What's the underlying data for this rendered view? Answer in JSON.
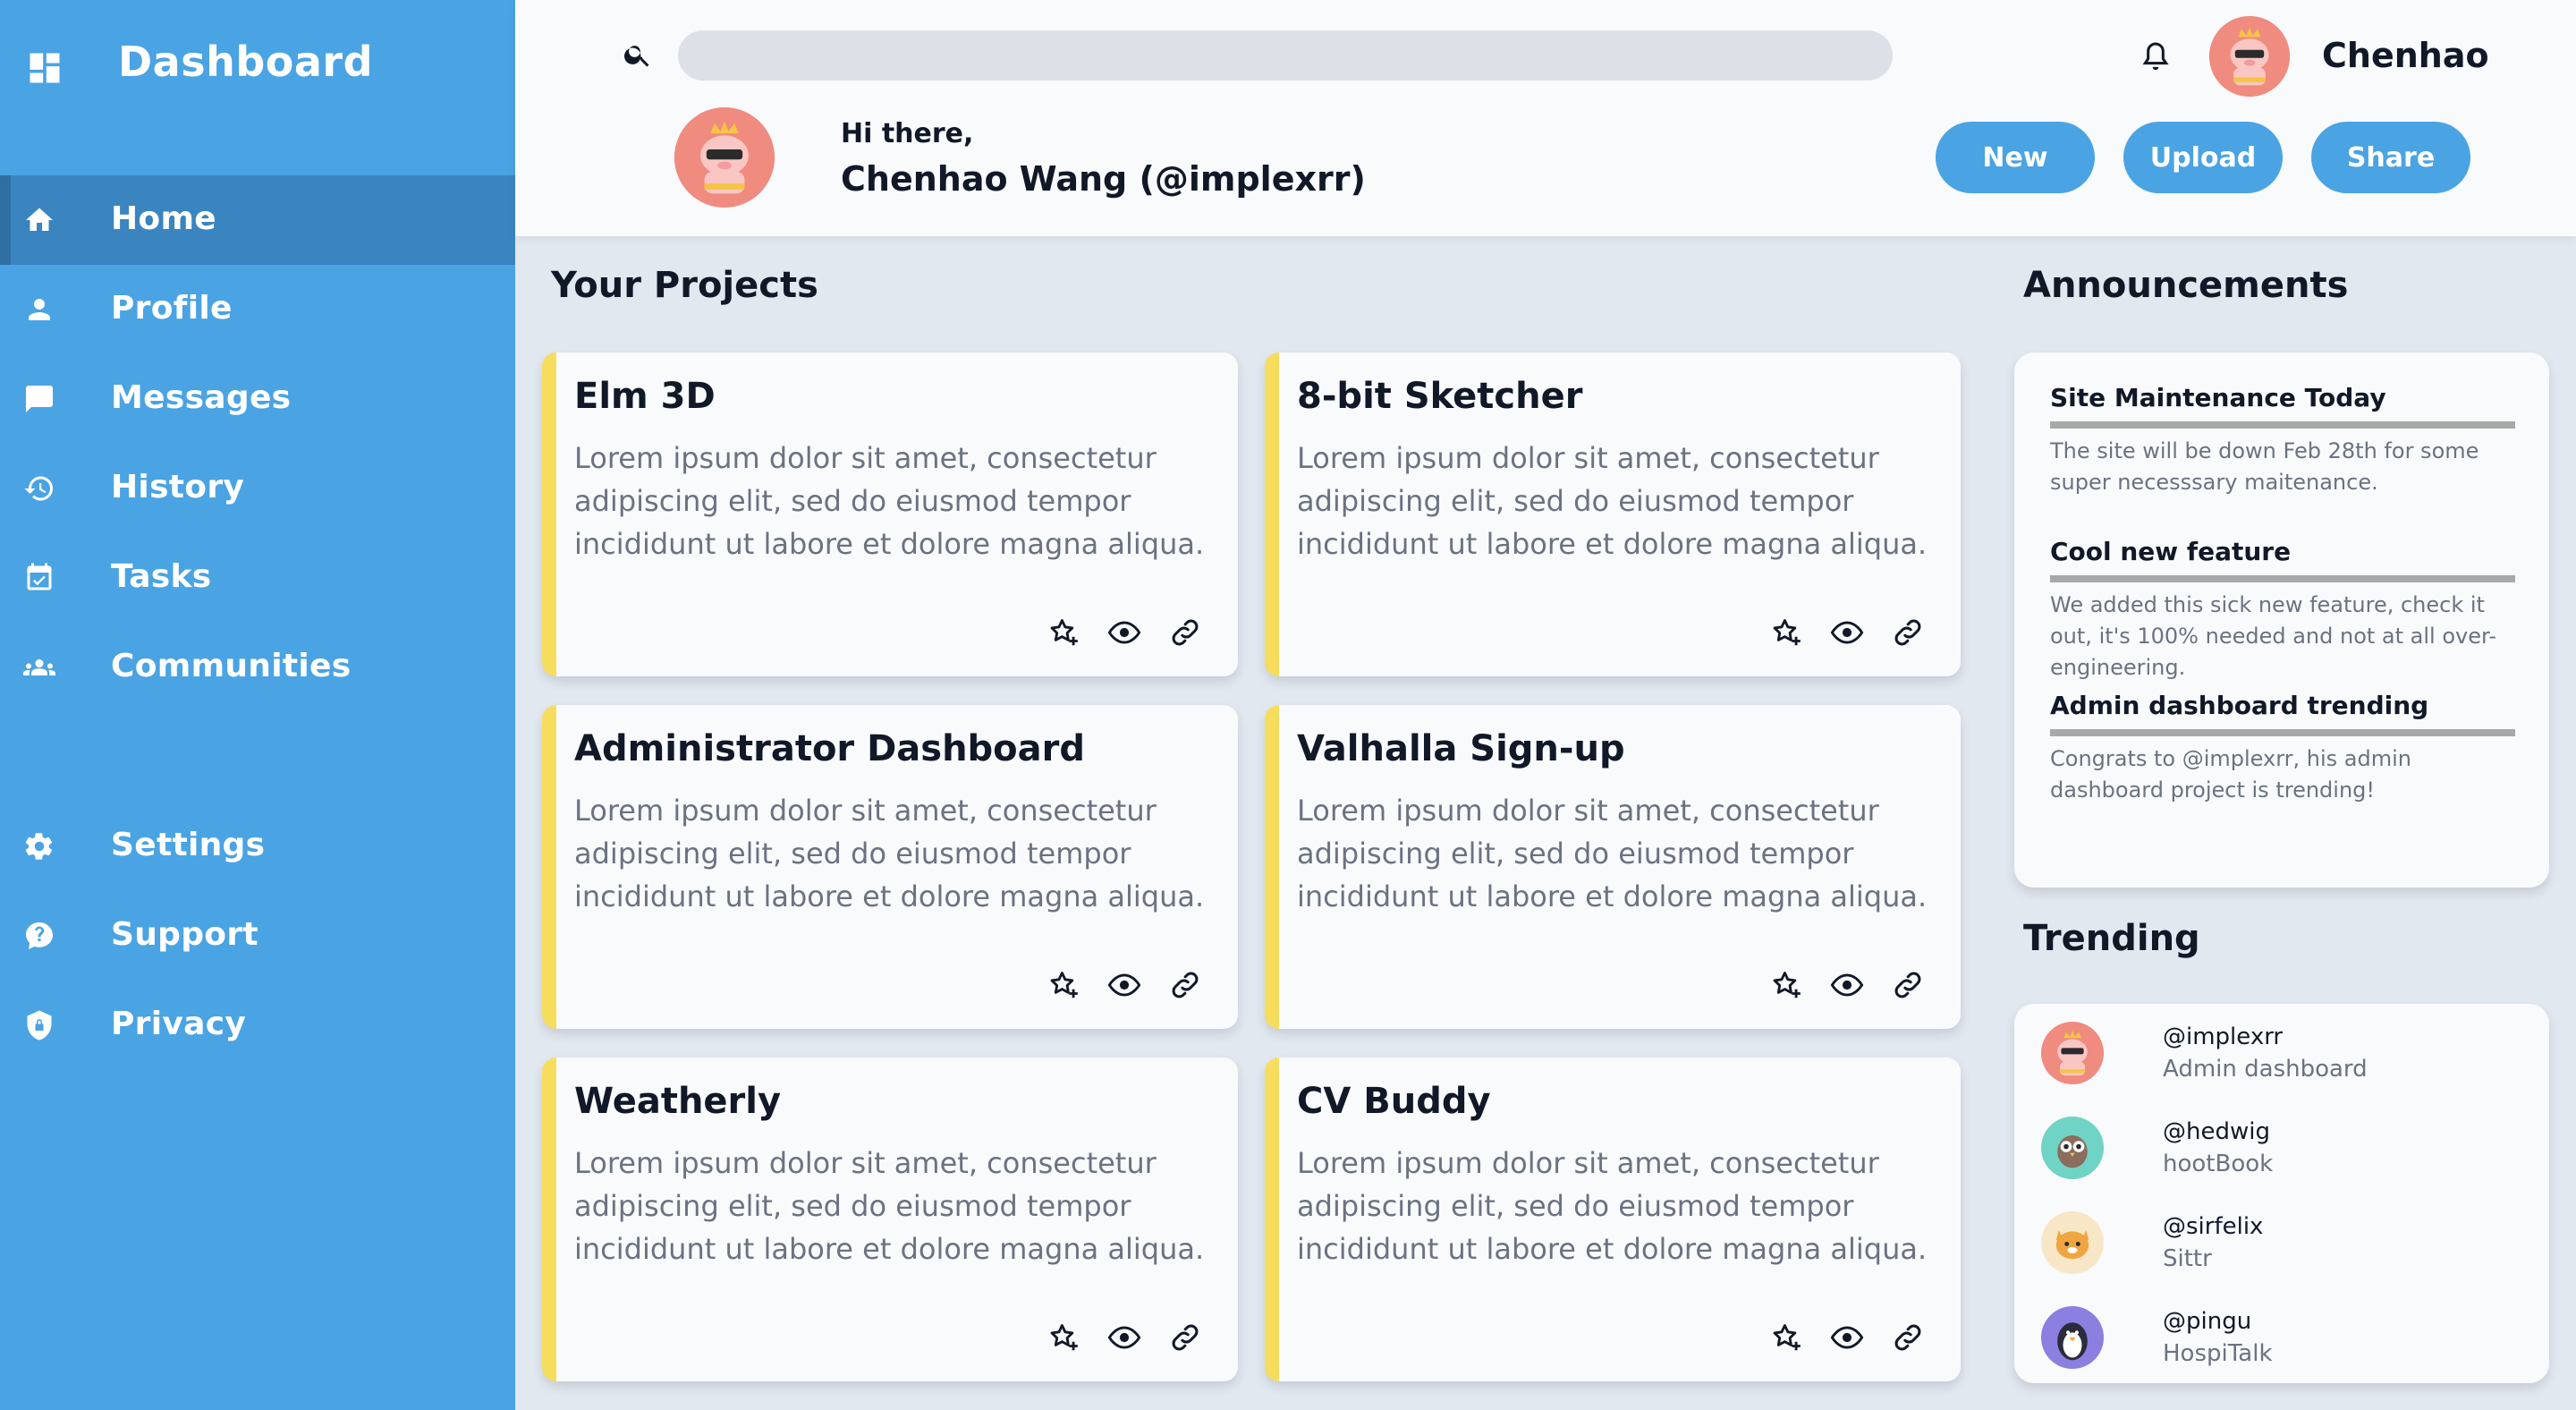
{
  "sidebar": {
    "title": "Dashboard",
    "items": [
      {
        "label": "Home",
        "icon": "home-icon",
        "active": true
      },
      {
        "label": "Profile",
        "icon": "person-icon"
      },
      {
        "label": "Messages",
        "icon": "chat-icon"
      },
      {
        "label": "History",
        "icon": "history-icon"
      },
      {
        "label": "Tasks",
        "icon": "calendar-check-icon"
      },
      {
        "label": "Communities",
        "icon": "group-icon"
      }
    ],
    "bottom_items": [
      {
        "label": "Settings",
        "icon": "gear-icon"
      },
      {
        "label": "Support",
        "icon": "help-chat-icon"
      },
      {
        "label": "Privacy",
        "icon": "shield-lock-icon"
      }
    ]
  },
  "header": {
    "search": {
      "value": "",
      "placeholder": ""
    },
    "username": "Chenhao",
    "greeting": "Hi there,",
    "full_name": "Chenhao Wang (@implexrr)",
    "buttons": {
      "new": "New",
      "upload": "Upload",
      "share": "Share"
    }
  },
  "projects": {
    "title": "Your Projects",
    "items": [
      {
        "title": "Elm 3D",
        "description": "Lorem ipsum dolor sit amet, consectetur adipiscing elit, sed do eiusmod tempor incididunt ut labore et dolore magna aliqua."
      },
      {
        "title": "8-bit Sketcher",
        "description": "Lorem ipsum dolor sit amet, consectetur adipiscing elit, sed do eiusmod tempor incididunt ut labore et dolore magna aliqua."
      },
      {
        "title": "Administrator Dashboard",
        "description": "Lorem ipsum dolor sit amet, consectetur adipiscing elit, sed do eiusmod tempor incididunt ut labore et dolore magna aliqua."
      },
      {
        "title": "Valhalla Sign-up",
        "description": "Lorem ipsum dolor sit amet, consectetur adipiscing elit, sed do eiusmod tempor incididunt ut labore et dolore magna aliqua."
      },
      {
        "title": "Weatherly",
        "description": "Lorem ipsum dolor sit amet, consectetur adipiscing elit, sed do eiusmod tempor incididunt ut labore et dolore magna aliqua."
      },
      {
        "title": "CV Buddy",
        "description": "Lorem ipsum dolor sit amet, consectetur adipiscing elit, sed do eiusmod tempor incididunt ut labore et dolore magna aliqua."
      }
    ],
    "actions": [
      "star-add-icon",
      "eye-icon",
      "link-icon"
    ]
  },
  "announcements": {
    "title": "Announcements",
    "items": [
      {
        "title": "Site Maintenance Today",
        "body": "The site will be down Feb 28th for some super necesssary maitenance."
      },
      {
        "title": "Cool new feature",
        "body": "We added this sick new feature, check it out, it's 100% needed and not at all over-engineering."
      },
      {
        "title": "Admin dashboard trending",
        "body": "Congrats to @implexrr, his admin dashboard project is trending!"
      }
    ]
  },
  "trending": {
    "title": "Trending",
    "items": [
      {
        "handle": "@implexrr",
        "project": "Admin dashboard",
        "avatar_color": "#ef8b7f"
      },
      {
        "handle": "@hedwig",
        "project": "hootBook",
        "avatar_color": "#6fd3c5"
      },
      {
        "handle": "@sirfelix",
        "project": "Sittr",
        "avatar_color": "#f7e7c7"
      },
      {
        "handle": "@pingu",
        "project": "HospiTalk",
        "avatar_color": "#8b7fe0"
      }
    ]
  },
  "colors": {
    "sidebar": "#4aa3e3",
    "sidebar_active": "#3a85c0",
    "accent": "#4aa3e3",
    "card_border": "#f7dd5e",
    "background": "#e2e8f0",
    "surface": "#f8fafc"
  }
}
